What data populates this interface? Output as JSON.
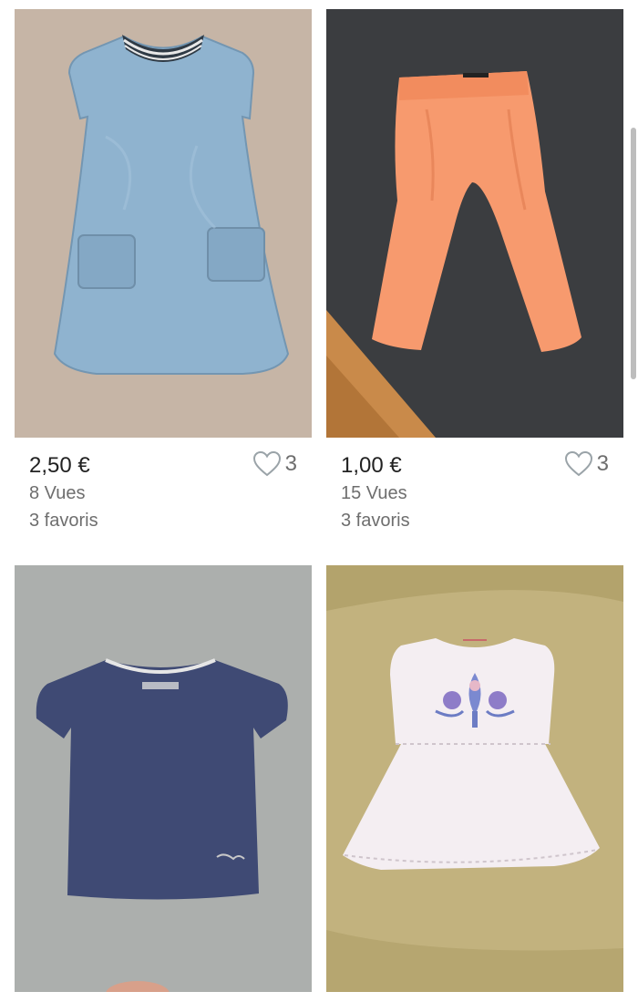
{
  "listings": [
    {
      "price": "2,50 €",
      "views": "8 Vues",
      "favorites": "3 favoris",
      "like_count": "3",
      "item": "denim dress"
    },
    {
      "price": "1,00 €",
      "views": "15 Vues",
      "favorites": "3 favoris",
      "like_count": "3",
      "item": "orange leggings"
    },
    {
      "item": "navy t-shirt"
    },
    {
      "item": "white embroidered top"
    }
  ],
  "colors": {
    "price_text": "#222222",
    "meta_text": "#6e6e6e",
    "heart_outline": "#9aa3a8"
  }
}
